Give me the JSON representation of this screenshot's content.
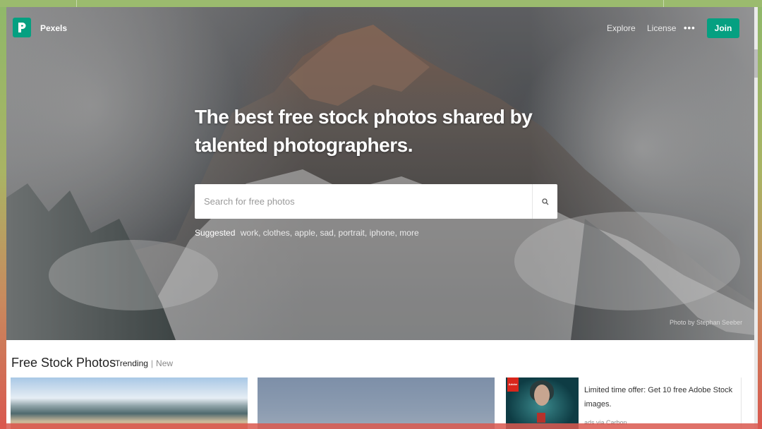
{
  "nav": {
    "brand": "Pexels",
    "links": [
      "Explore",
      "License"
    ],
    "more": "•••",
    "join": "Join"
  },
  "hero": {
    "headline_line1": "The best free stock photos shared by",
    "headline_line2": "talented photographers.",
    "search_placeholder": "Search for free photos",
    "suggested_label": "Suggested",
    "suggested_tags": [
      "work,",
      "clothes,",
      "apple,",
      "sad,",
      "portrait,",
      "iphone,",
      "more"
    ],
    "credit": "Photo by Stephan Seeber"
  },
  "content": {
    "section_title": "Free Stock Photos",
    "tab_trending": "Trending",
    "tab_separator": "|",
    "tab_new": "New"
  },
  "ad": {
    "badge": "Adobe",
    "text": "Limited time offer: Get 10 free Adobe Stock images.",
    "via": "ads via Carbon"
  },
  "colors": {
    "accent": "#05a081"
  }
}
